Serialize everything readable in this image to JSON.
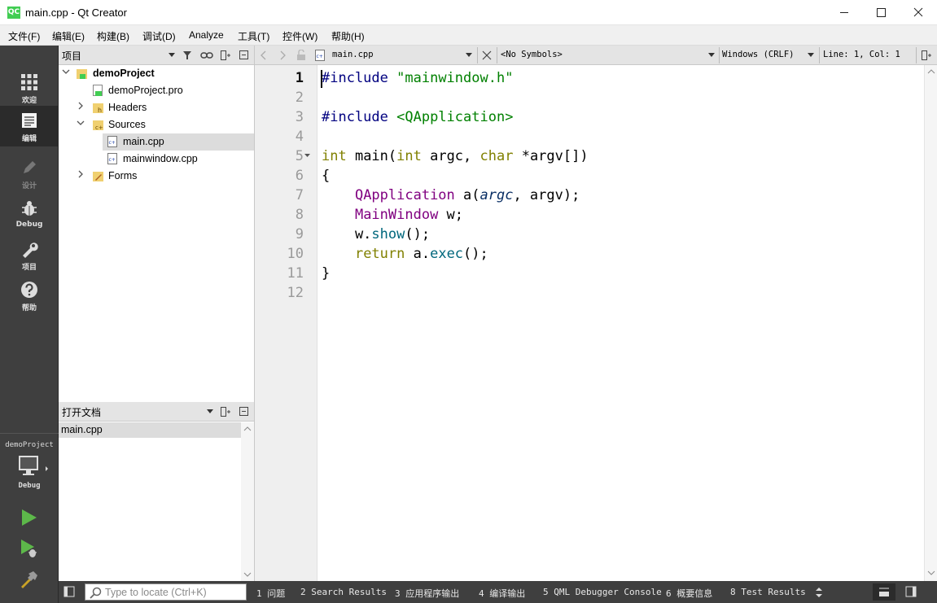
{
  "window": {
    "app_icon_text": "QC",
    "title": "main.cpp - Qt Creator",
    "min_glyph": "—",
    "max_glyph": "☐",
    "close_glyph": "✕"
  },
  "menu": [
    "文件(F)",
    "编辑(E)",
    "构建(B)",
    "调试(D)",
    "Analyze",
    "工具(T)",
    "控件(W)",
    "帮助(H)"
  ],
  "modes": [
    {
      "label": "欢迎",
      "icon": "welcome-grid-icon"
    },
    {
      "label": "编辑",
      "icon": "edit-document-icon"
    },
    {
      "label": "设计",
      "icon": "design-pencil-icon"
    },
    {
      "label": "Debug",
      "icon": "debug-bug-icon"
    },
    {
      "label": "项目",
      "icon": "projects-wrench-icon"
    },
    {
      "label": "帮助",
      "icon": "help-question-icon"
    }
  ],
  "kit": {
    "project": "demoProject",
    "build_mode": "Debug"
  },
  "projects_pane": {
    "title": "项目",
    "tree": [
      {
        "label": "demoProject",
        "level": 0,
        "expanded": true,
        "icon": "project-folder-icon"
      },
      {
        "label": "demoProject.pro",
        "level": 1,
        "icon": "pro-file-icon"
      },
      {
        "label": "Headers",
        "level": 1,
        "expanded": false,
        "icon": "headers-folder-icon"
      },
      {
        "label": "Sources",
        "level": 1,
        "expanded": true,
        "icon": "sources-folder-icon"
      },
      {
        "label": "main.cpp",
        "level": 2,
        "selected": true,
        "icon": "cpp-file-icon"
      },
      {
        "label": "mainwindow.cpp",
        "level": 2,
        "icon": "cpp-file-icon"
      },
      {
        "label": "Forms",
        "level": 1,
        "expanded": false,
        "icon": "forms-folder-icon"
      }
    ]
  },
  "open_docs_pane": {
    "title": "打开文档",
    "documents": [
      "main.cpp"
    ]
  },
  "editor_toolbar": {
    "file": "main.cpp",
    "symbols": "<No Symbols>",
    "line_ending": "Windows (CRLF)",
    "position": "Line: 1, Col: 1"
  },
  "editor": {
    "line_numbers": [
      "1",
      "2",
      "3",
      "4",
      "5",
      "6",
      "7",
      "8",
      "9",
      "10",
      "11",
      "12"
    ],
    "current_line": 1,
    "fold_marker_line": 5
  },
  "locator": {
    "placeholder": "Type to locate (Ctrl+K)"
  },
  "output_tabs": [
    "1 问题",
    "2 Search Results",
    "3 应用程序输出",
    "4 编译输出",
    "5 QML Debugger Console",
    "6 概要信息",
    "8 Test Results"
  ],
  "colors": {
    "sidebar_bg": "#3f3f3f",
    "keyword": "#808000",
    "preprocessor": "#000080",
    "string": "#008000",
    "type": "#800080",
    "function": "#00677c",
    "run_green": "#5db84a",
    "qt_green": "#41cd52"
  }
}
